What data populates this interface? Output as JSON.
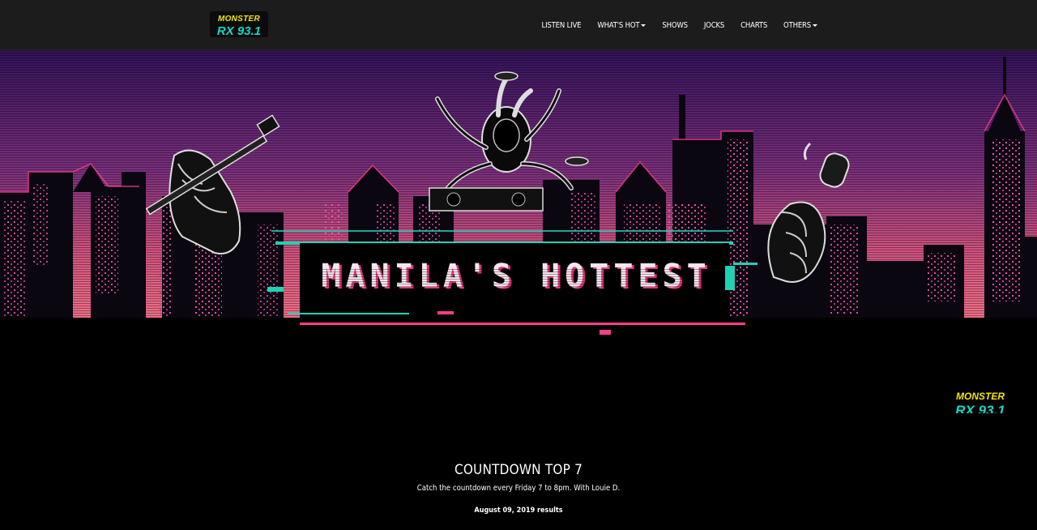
{
  "brand": {
    "logo_line1": "MONSTER",
    "logo_line2": "RX 93.1",
    "logo_yellow": "#f2e600",
    "logo_teal": "#14d7c8"
  },
  "nav": {
    "items": [
      {
        "label": "LISTEN LIVE",
        "dropdown": false
      },
      {
        "label": "WHAT'S HOT",
        "dropdown": true
      },
      {
        "label": "SHOWS",
        "dropdown": false
      },
      {
        "label": "JOCKS",
        "dropdown": false
      },
      {
        "label": "CHARTS",
        "dropdown": false
      },
      {
        "label": "OTHERS",
        "dropdown": true
      }
    ]
  },
  "hero": {
    "banner_text": "MANILA'S HOTTEST",
    "sky_top": "#3a1560",
    "sky_bottom": "#e05a8a",
    "accent_pink": "#ff3d8b",
    "accent_teal": "#1fd1b5",
    "corner_logo_line1": "MONSTER",
    "corner_logo_line2": "RX 93.1"
  },
  "countdown": {
    "title": "COUNTDOWN TOP 7",
    "subtitle": "Catch the countdown every Friday 7 to 8pm. With Louie D.",
    "date": "August 09, 2019 results"
  }
}
